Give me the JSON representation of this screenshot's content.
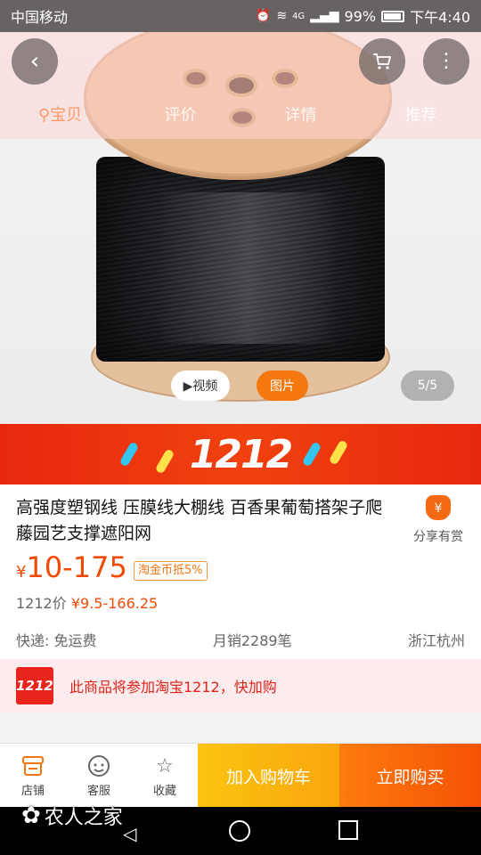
{
  "status_bar": {
    "carrier": "中国移动",
    "signal_label": "4G",
    "battery": "99%",
    "time": "下午4:40"
  },
  "header": {
    "back_icon": "chevron-left-icon",
    "cart_icon": "cart-icon",
    "more_icon": "more-vertical-icon",
    "tabs": [
      {
        "label": "宝贝",
        "active": true
      },
      {
        "label": "评价",
        "active": false
      },
      {
        "label": "详情",
        "active": false
      },
      {
        "label": "推荐",
        "active": false
      }
    ]
  },
  "gallery": {
    "video_label": "▶视频",
    "photo_label": "图片",
    "page_indicator": "5/5"
  },
  "banner": {
    "logo_text": "1212"
  },
  "product": {
    "title": "高强度塑钢线 压膜线大棚线 百香果葡萄搭架子爬藤园艺支撑遮阳网",
    "share_label": "分享有赏",
    "price_symbol": "¥",
    "price_range": "10-175",
    "coin_badge": "淘金币抵5%",
    "event_price_label": "1212价",
    "event_price_value": "¥9.5-166.25",
    "shipping": "快递: 免运费",
    "monthly_sales": "月销2289笔",
    "location": "浙江杭州"
  },
  "notice": {
    "logo_text": "1212",
    "text": "此商品将参加淘宝1212，快加购"
  },
  "bottom_bar": {
    "store_label": "店铺",
    "service_label": "客服",
    "favorite_label": "收藏",
    "add_to_cart_label": "加入购物车",
    "buy_now_label": "立即购买"
  },
  "watermark": {
    "text": "农人之家"
  },
  "colors": {
    "accent_orange": "#f04a07",
    "banner_red": "#e7280e",
    "cart_yellow": "#fbc411",
    "buy_orange": "#f55205"
  }
}
